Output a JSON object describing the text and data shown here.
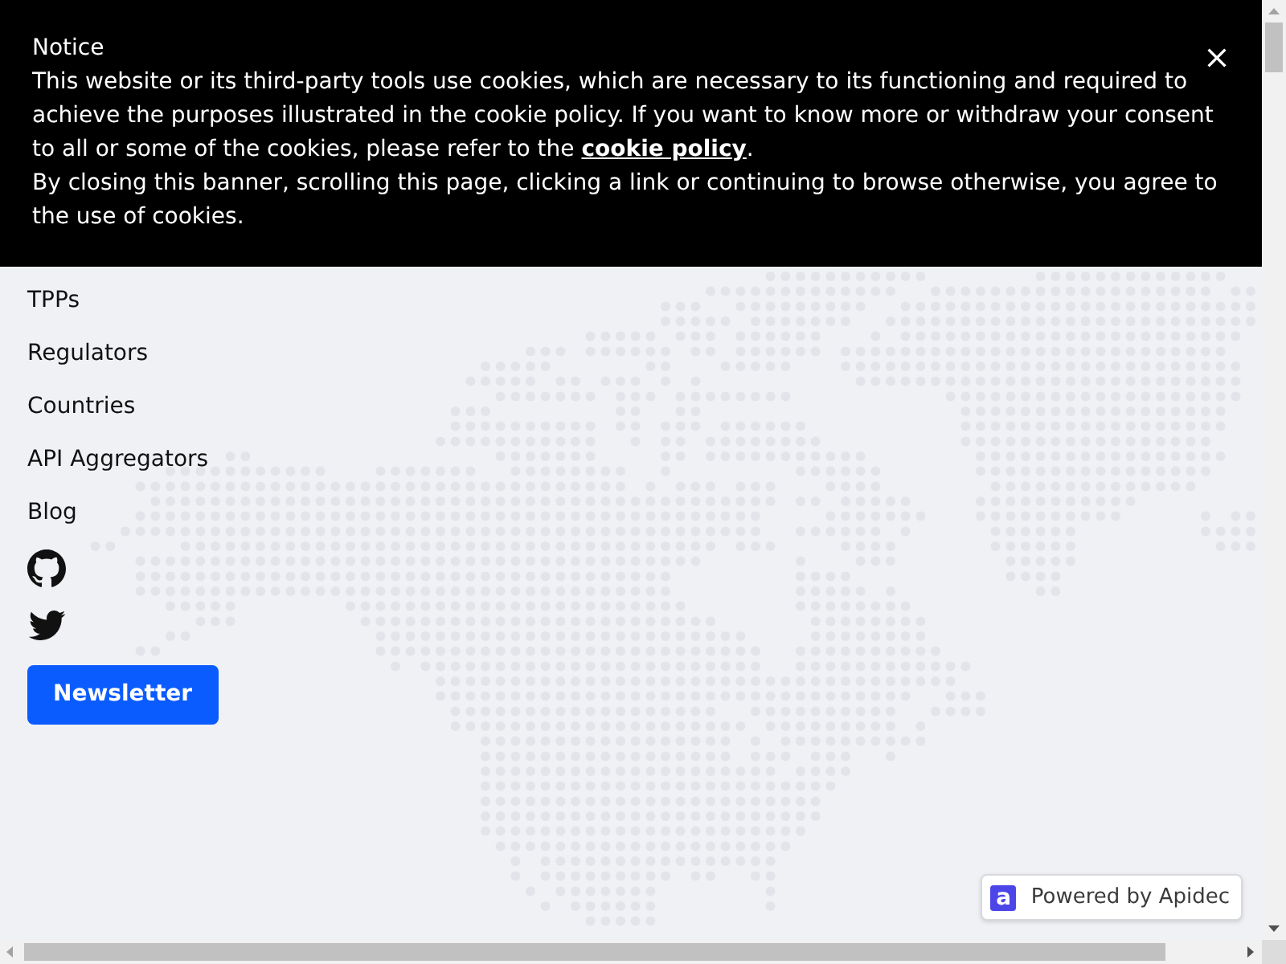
{
  "cookie_notice": {
    "title": "Notice",
    "paragraphs": [
      {
        "text": "This website or its third-party tools use cookies, which are necessary to its functioning and required to achieve the purposes illustrated in the cookie policy. If you want to know more or withdraw your consent to all or some of the cookies, please refer to the ",
        "link": "cookie policy",
        "text_after": "."
      },
      {
        "text": "By closing this banner, scrolling this page, clicking a link or continuing to browse otherwise, you agree to the use of cookies."
      }
    ]
  },
  "nav_links": [
    "TPPs",
    "Regulators",
    "Countries",
    "API Aggregators",
    "Blog"
  ],
  "newsletter_button": "Newsletter",
  "powered_by": {
    "logo_letter": "a",
    "text": "Powered by Apidec"
  }
}
